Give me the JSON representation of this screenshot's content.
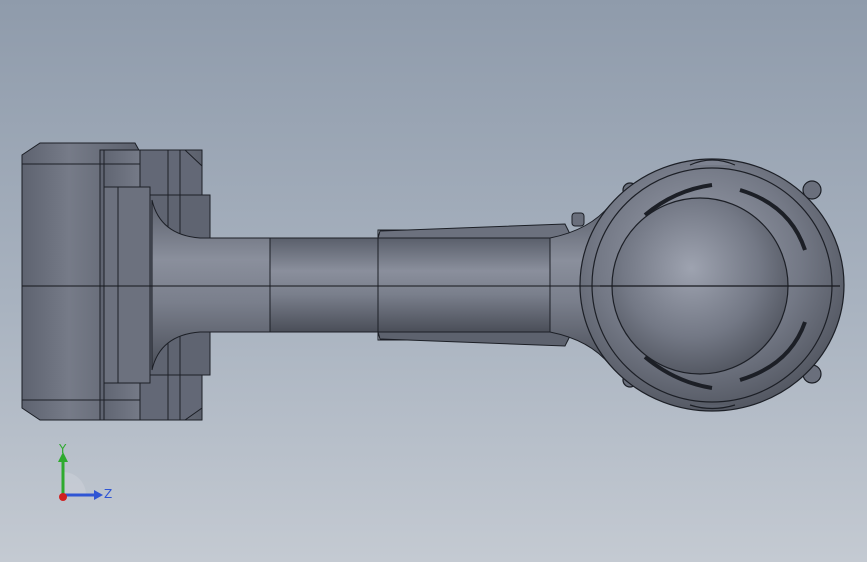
{
  "viewport": {
    "background_top": "#8f9bab",
    "background_bottom": "#c4cad2",
    "model_color": "#6b707d",
    "edge_color": "#1c1f26"
  },
  "triad": {
    "y_label": "Y",
    "z_label": "Z",
    "y_color": "#2eaa2e",
    "z_color": "#2f55d4",
    "x_color": "#d02020"
  }
}
